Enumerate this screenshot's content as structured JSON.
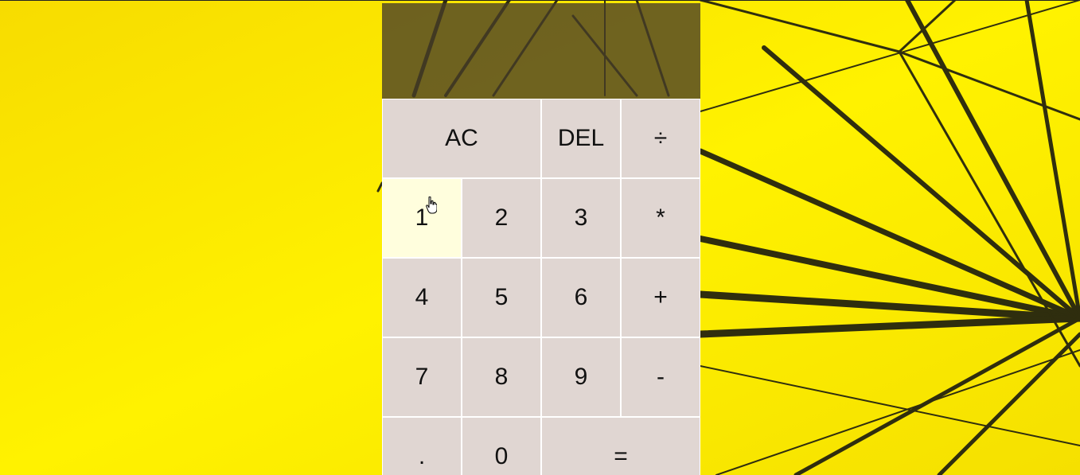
{
  "calculator": {
    "display": {
      "previous_operand": "",
      "current_operand": ""
    },
    "keys": [
      {
        "label": "AC",
        "role": "clear",
        "span": 2
      },
      {
        "label": "DEL",
        "role": "delete",
        "span": 1
      },
      {
        "label": "÷",
        "role": "operation",
        "span": 1
      },
      {
        "label": "1",
        "role": "number",
        "span": 1,
        "hovered": true
      },
      {
        "label": "2",
        "role": "number",
        "span": 1
      },
      {
        "label": "3",
        "role": "number",
        "span": 1
      },
      {
        "label": "*",
        "role": "operation",
        "span": 1
      },
      {
        "label": "4",
        "role": "number",
        "span": 1
      },
      {
        "label": "5",
        "role": "number",
        "span": 1
      },
      {
        "label": "6",
        "role": "number",
        "span": 1
      },
      {
        "label": "+",
        "role": "operation",
        "span": 1
      },
      {
        "label": "7",
        "role": "number",
        "span": 1
      },
      {
        "label": "8",
        "role": "number",
        "span": 1
      },
      {
        "label": "9",
        "role": "number",
        "span": 1
      },
      {
        "label": "-",
        "role": "operation",
        "span": 1
      },
      {
        "label": ".",
        "role": "number",
        "span": 1
      },
      {
        "label": "0",
        "role": "number",
        "span": 1
      },
      {
        "label": "=",
        "role": "equals",
        "span": 2
      }
    ]
  },
  "colors": {
    "background": "#f9e400",
    "display": "#463c28",
    "key": "#e0d6d2",
    "key_hover": "#fffff0",
    "key_border": "#ffffff",
    "text": "#111111"
  }
}
